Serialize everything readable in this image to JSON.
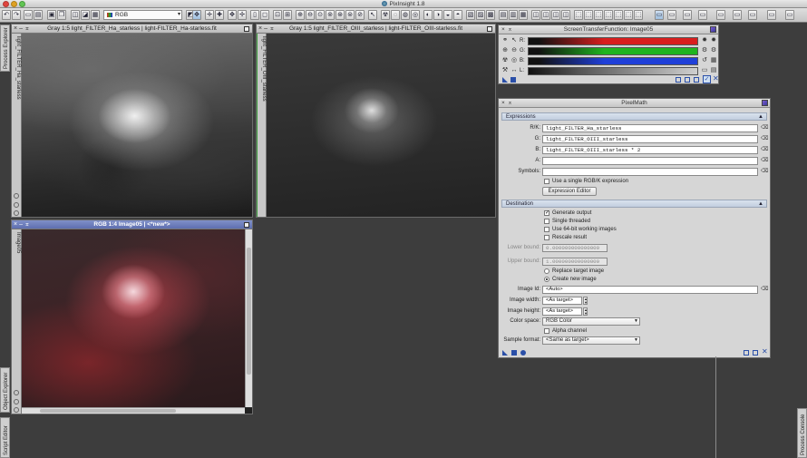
{
  "app": {
    "title": "PixInsight 1.8"
  },
  "toolbar": {
    "colorspace": "RGB"
  },
  "side_tabs": {
    "process_explorer": "Process Explorer",
    "object_explorer": "Object Explorer",
    "script_editor": "Script Editor",
    "process_console": "Process Console"
  },
  "image_windows": [
    {
      "title": "Gray 1:5 light_FILTER_Ha_starless | light-FILTER_Ha-starless.fit",
      "tab": "light_FILTER_Ha_starless"
    },
    {
      "title": "Gray 1:5 light_FILTER_OIII_starless | light-FILTER_OIII-starless.fit",
      "tab": "light_FILTER_OIII_starless"
    },
    {
      "title": "RGB 1:4 Image05 | <*new*>",
      "tab": "Image05"
    }
  ],
  "stf": {
    "title": "ScreenTransferFunction: Image05",
    "channels": [
      {
        "label": "R:",
        "color": "#d81e1e"
      },
      {
        "label": "G:",
        "color": "#1fb41f"
      },
      {
        "label": "B:",
        "color": "#1f3fd8"
      },
      {
        "label": "L:",
        "color": "#cfcfcf"
      }
    ]
  },
  "pixelmath": {
    "title": "PixelMath",
    "expressions_header": "Expressions",
    "rk_label": "R/K:",
    "rk_value": "light_FILTER_Ha_starless",
    "g_label": "G:",
    "g_value": "light_FILTER_OIII_starless",
    "b_label": "B:",
    "b_value": "light_FILTER_OIII_starless * 2",
    "a_label": "A:",
    "a_value": "",
    "symbols_label": "Symbols:",
    "symbols_value": "",
    "single_rgbk": "Use a single RGB/K expression",
    "expression_editor": "Expression Editor",
    "destination_header": "Destination",
    "generate_output": "Generate output",
    "single_threaded": "Single threaded",
    "use_64bit": "Use 64-bit working images",
    "rescale_result": "Rescale result",
    "lower_bound_label": "Lower bound:",
    "lower_bound_value": "0.000000000000000",
    "upper_bound_label": "Upper bound:",
    "upper_bound_value": "1.000000000000000",
    "replace_target": "Replace target image",
    "create_new": "Create new image",
    "image_id_label": "Image Id:",
    "image_id_value": "<Auto>",
    "image_width_label": "Image width:",
    "image_width_value": "<As target>",
    "image_height_label": "Image height:",
    "image_height_value": "<As target>",
    "color_space_label": "Color space:",
    "color_space_value": "RGB Color",
    "alpha_channel": "Alpha channel",
    "sample_format_label": "Sample format:",
    "sample_format_value": "<Same as target>"
  }
}
